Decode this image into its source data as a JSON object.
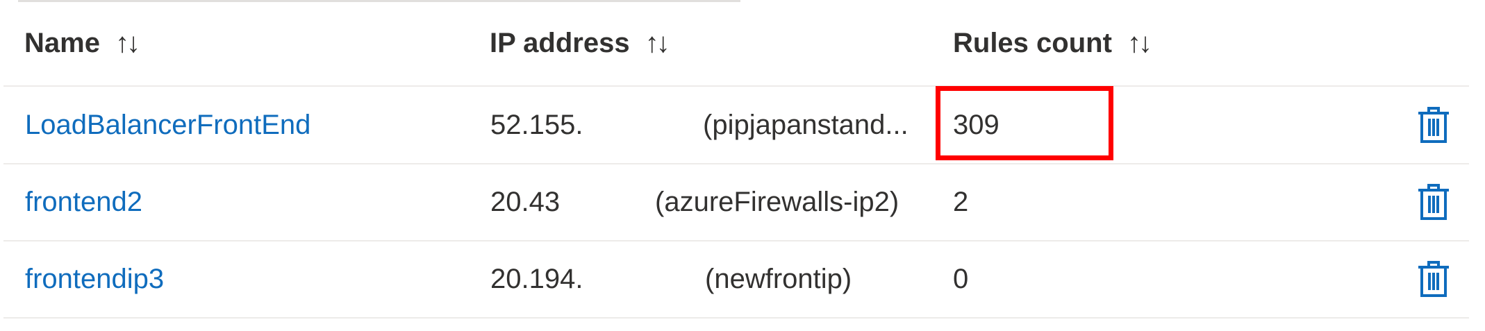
{
  "table": {
    "columns": [
      {
        "label": "Name",
        "sort_icon": "↑↓"
      },
      {
        "label": "IP address",
        "sort_icon": "↑↓"
      },
      {
        "label": "Rules count",
        "sort_icon": "↑↓"
      }
    ],
    "rows": [
      {
        "name": "LoadBalancerFrontEnd",
        "ip": "52.155.",
        "ip_name": "(pipjapanstand...",
        "rules_count": "309",
        "action_icon": "trash-icon"
      },
      {
        "name": "frontend2",
        "ip": "20.43",
        "ip_name": "(azureFirewalls-ip2)",
        "rules_count": "2",
        "action_icon": "trash-icon"
      },
      {
        "name": "frontendip3",
        "ip": "20.194.",
        "ip_name": "(newfrontip)",
        "rules_count": "0",
        "action_icon": "trash-icon"
      }
    ]
  },
  "colors": {
    "link": "#0f6cbd",
    "text": "#323130",
    "divider": "#edebe9",
    "highlight": "#ff0000"
  }
}
